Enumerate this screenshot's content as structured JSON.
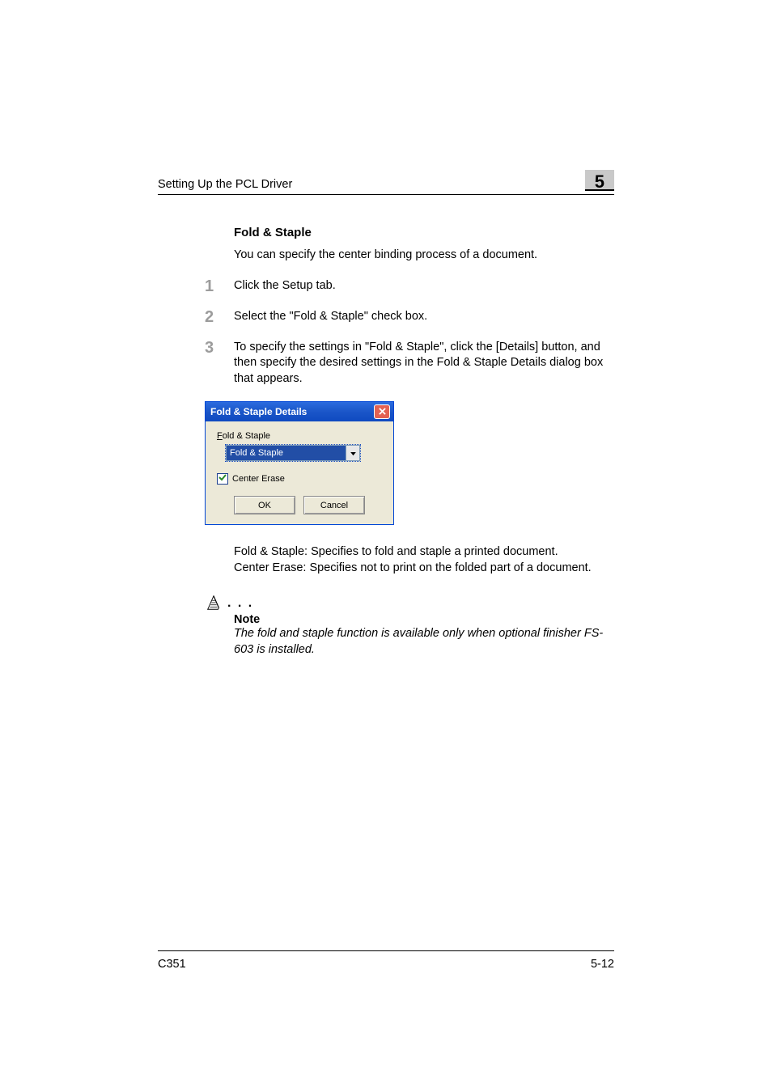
{
  "header": {
    "title": "Setting Up the PCL Driver",
    "chapter_number": "5"
  },
  "section": {
    "title": "Fold & Staple",
    "intro": "You can specify the center binding process of a document."
  },
  "steps": [
    {
      "num": "1",
      "text": "Click the Setup tab."
    },
    {
      "num": "2",
      "text": "Select the \"Fold & Staple\" check box."
    },
    {
      "num": "3",
      "text": "To specify the settings in \"Fold & Staple\", click the [Details] button, and then specify the desired settings in the Fold & Staple Details dialog box that appears."
    }
  ],
  "dialog": {
    "title": "Fold & Staple Details",
    "label_prefix": "F",
    "label_rest": "old & Staple",
    "select_value": "Fold & Staple",
    "center_prefix": "C",
    "center_rest": "enter Erase",
    "ok": "OK",
    "cancel": "Cancel"
  },
  "after_dialog": {
    "line1": "Fold & Staple: Specifies to fold and staple a printed document.",
    "line2": "Center Erase: Specifies not to print on the folded part of a document."
  },
  "note": {
    "dots": ". . .",
    "label": "Note",
    "text": "The fold and staple function is available only when optional finisher FS-603 is installed."
  },
  "footer": {
    "left": "C351",
    "right": "5-12"
  }
}
